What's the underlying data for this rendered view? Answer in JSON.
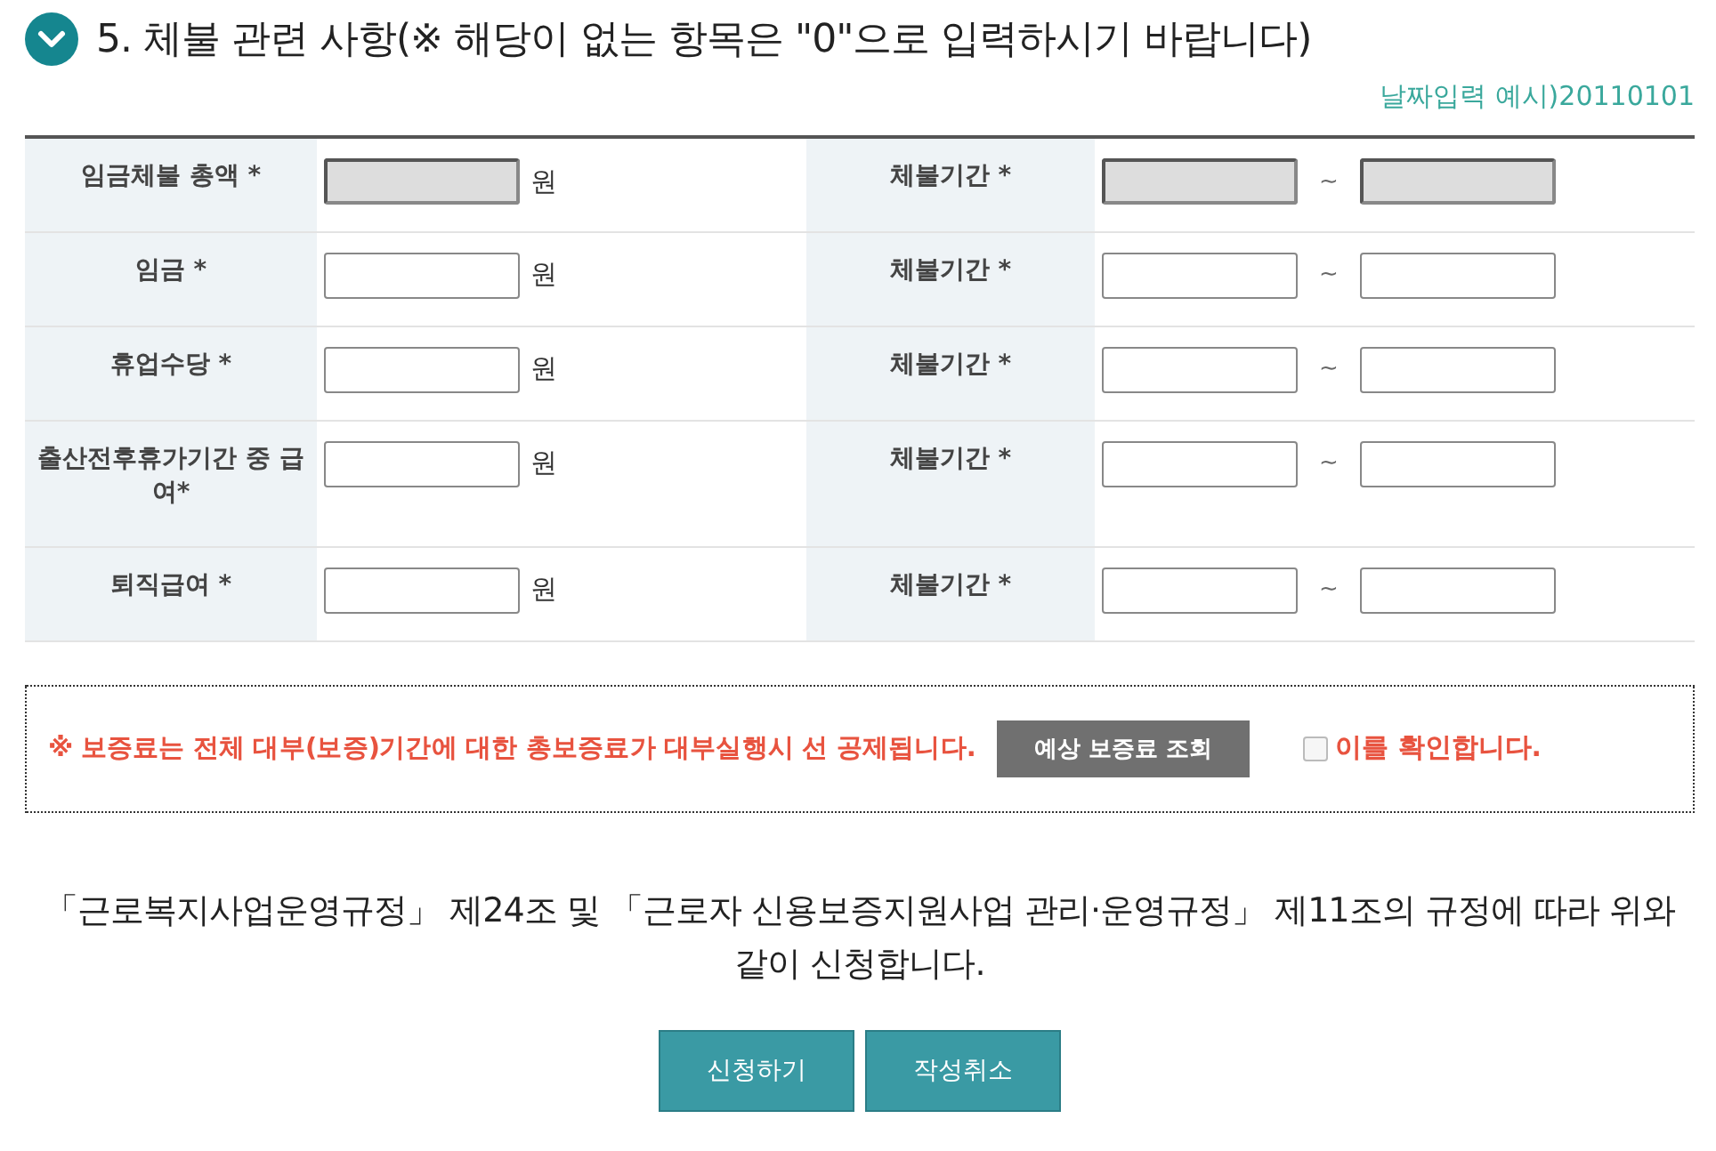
{
  "section": {
    "title": "5. 체불 관련 사항(※ 해당이 없는 항목은 \"0\"으로 입력하시기 바랍니다)",
    "date_hint": "날짜입력 예시)20110101"
  },
  "rows": [
    {
      "label": "임금체불 총액 *",
      "unit": "원",
      "disabled": true,
      "period_label": "체불기간 *",
      "tilde": "~"
    },
    {
      "label": "임금 *",
      "unit": "원",
      "disabled": false,
      "period_label": "체불기간 *",
      "tilde": "~"
    },
    {
      "label": "휴업수당 *",
      "unit": "원",
      "disabled": false,
      "period_label": "체불기간 *",
      "tilde": "~"
    },
    {
      "label": "출산전후휴가기간 중 급여*",
      "unit": "원",
      "disabled": false,
      "period_label": "체불기간 *",
      "tilde": "~"
    },
    {
      "label": "퇴직급여 *",
      "unit": "원",
      "disabled": false,
      "period_label": "체불기간 *",
      "tilde": "~"
    }
  ],
  "notice": {
    "text": "※ 보증료는 전체 대부(보증)기간에 대한 총보증료가 대부실행시 선 공제됩니다.",
    "button": "예상 보증료 조회",
    "confirm_label": "이를 확인합니다.",
    "checked": false
  },
  "statement": "「근로복지사업운영규정」 제24조 및 「근로자 신용보증지원사업 관리·운영규정」 제11조의 규정에 따라 위와 같이 신청합니다.",
  "buttons": [
    "신청하기",
    "작성취소"
  ]
}
